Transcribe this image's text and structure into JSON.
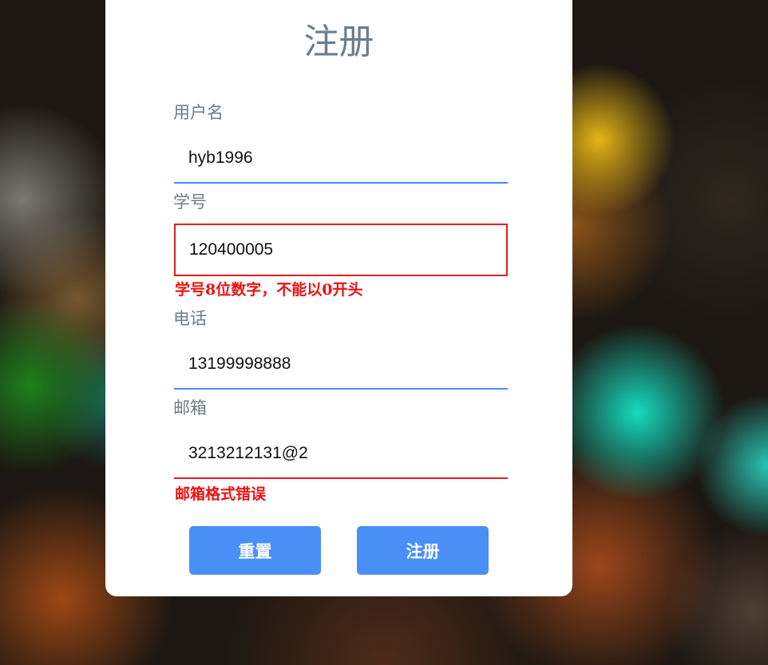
{
  "form": {
    "title": "注册",
    "username": {
      "label": "用户名",
      "value": "hyb1996"
    },
    "student_id": {
      "label": "学号",
      "value": "120400005",
      "error": "学号8位数字，不能以0开头"
    },
    "phone": {
      "label": "电话",
      "value": "13199998888"
    },
    "email": {
      "label": "邮箱",
      "value": "3213212131@2",
      "error": "邮箱格式错误"
    },
    "reset_label": "重置",
    "submit_label": "注册"
  },
  "colors": {
    "accent": "#4a8ff8",
    "error": "#ee1111",
    "label": "#6b7d8c"
  }
}
